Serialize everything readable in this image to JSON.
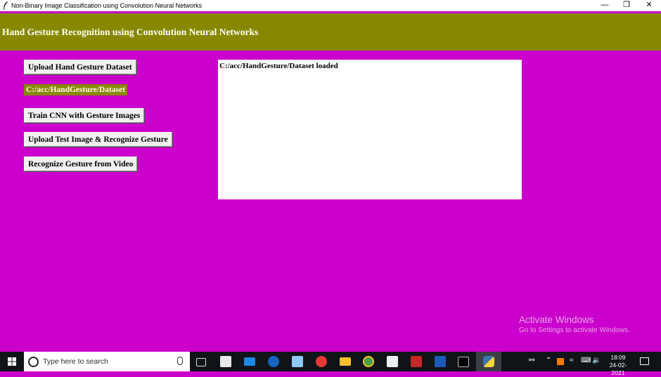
{
  "window": {
    "title": "Non-Binary Image Classification using Convolution Neural Networks",
    "minimize_glyph": "—",
    "maximize_glyph": "❐",
    "close_glyph": "✕"
  },
  "header": {
    "title": "Hand Gesture Recognition using Convolution Neural Networks"
  },
  "buttons": {
    "upload_dataset": "Upload Hand Gesture Dataset",
    "train_cnn": "Train CNN with Gesture Images",
    "upload_test": "Upload Test Image & Recognize Gesture",
    "recognize_video": "Recognize Gesture from Video"
  },
  "dataset_path_label": "C:/acc/HandGesture/Dataset",
  "output_text": "C:/acc/HandGesture/Dataset loaded",
  "watermark": {
    "line1": "Activate Windows",
    "line2": "Go to Settings to activate Windows."
  },
  "taskbar": {
    "search_placeholder": "Type here to search",
    "time": "18:09",
    "date": "24-02-2021",
    "icons": [
      "task-view-icon",
      "store-icon",
      "mail-icon",
      "edge-icon",
      "notepad-icon",
      "app-icon",
      "file-explorer-icon",
      "chrome-icon",
      "document-icon",
      "powerpoint-icon",
      "word-icon",
      "terminal-icon",
      "python-icon"
    ]
  },
  "colors": {
    "background": "#cc00cc",
    "header": "#888800",
    "text_area": "#ffffff"
  }
}
